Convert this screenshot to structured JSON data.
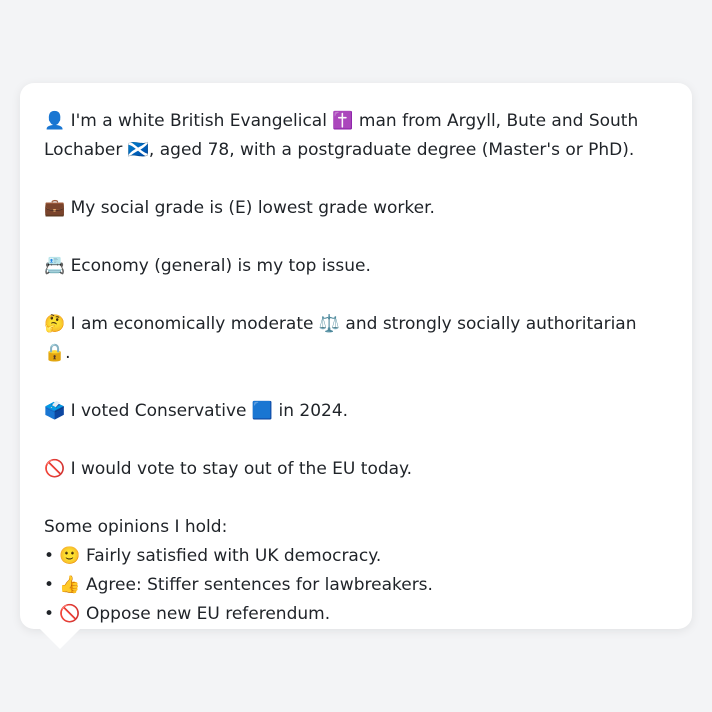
{
  "profile": {
    "line1": "👤 I'm a white British Evangelical ✝️ man from Argyll, Bute and South Lochaber 🏴󠁧󠁢󠁳󠁣󠁴󠁿, aged 78, with a postgraduate degree (Master's or PhD).",
    "line2": "💼 My social grade is (E) lowest grade worker.",
    "line3": "📇 Economy (general) is my top issue.",
    "line4": "🤔 I am economically moderate ⚖️ and strongly socially authoritarian 🔒.",
    "line5": "🗳️ I voted Conservative 🟦 in 2024.",
    "line6": "🚫 I would vote to stay out of the EU today."
  },
  "opinions": {
    "heading": "Some opinions I hold:",
    "items": [
      "• 🙂 Fairly satisfied with UK democracy.",
      "• 👍 Agree: Stiffer sentences for lawbreakers.",
      "• 🚫 Oppose new EU referendum."
    ]
  }
}
